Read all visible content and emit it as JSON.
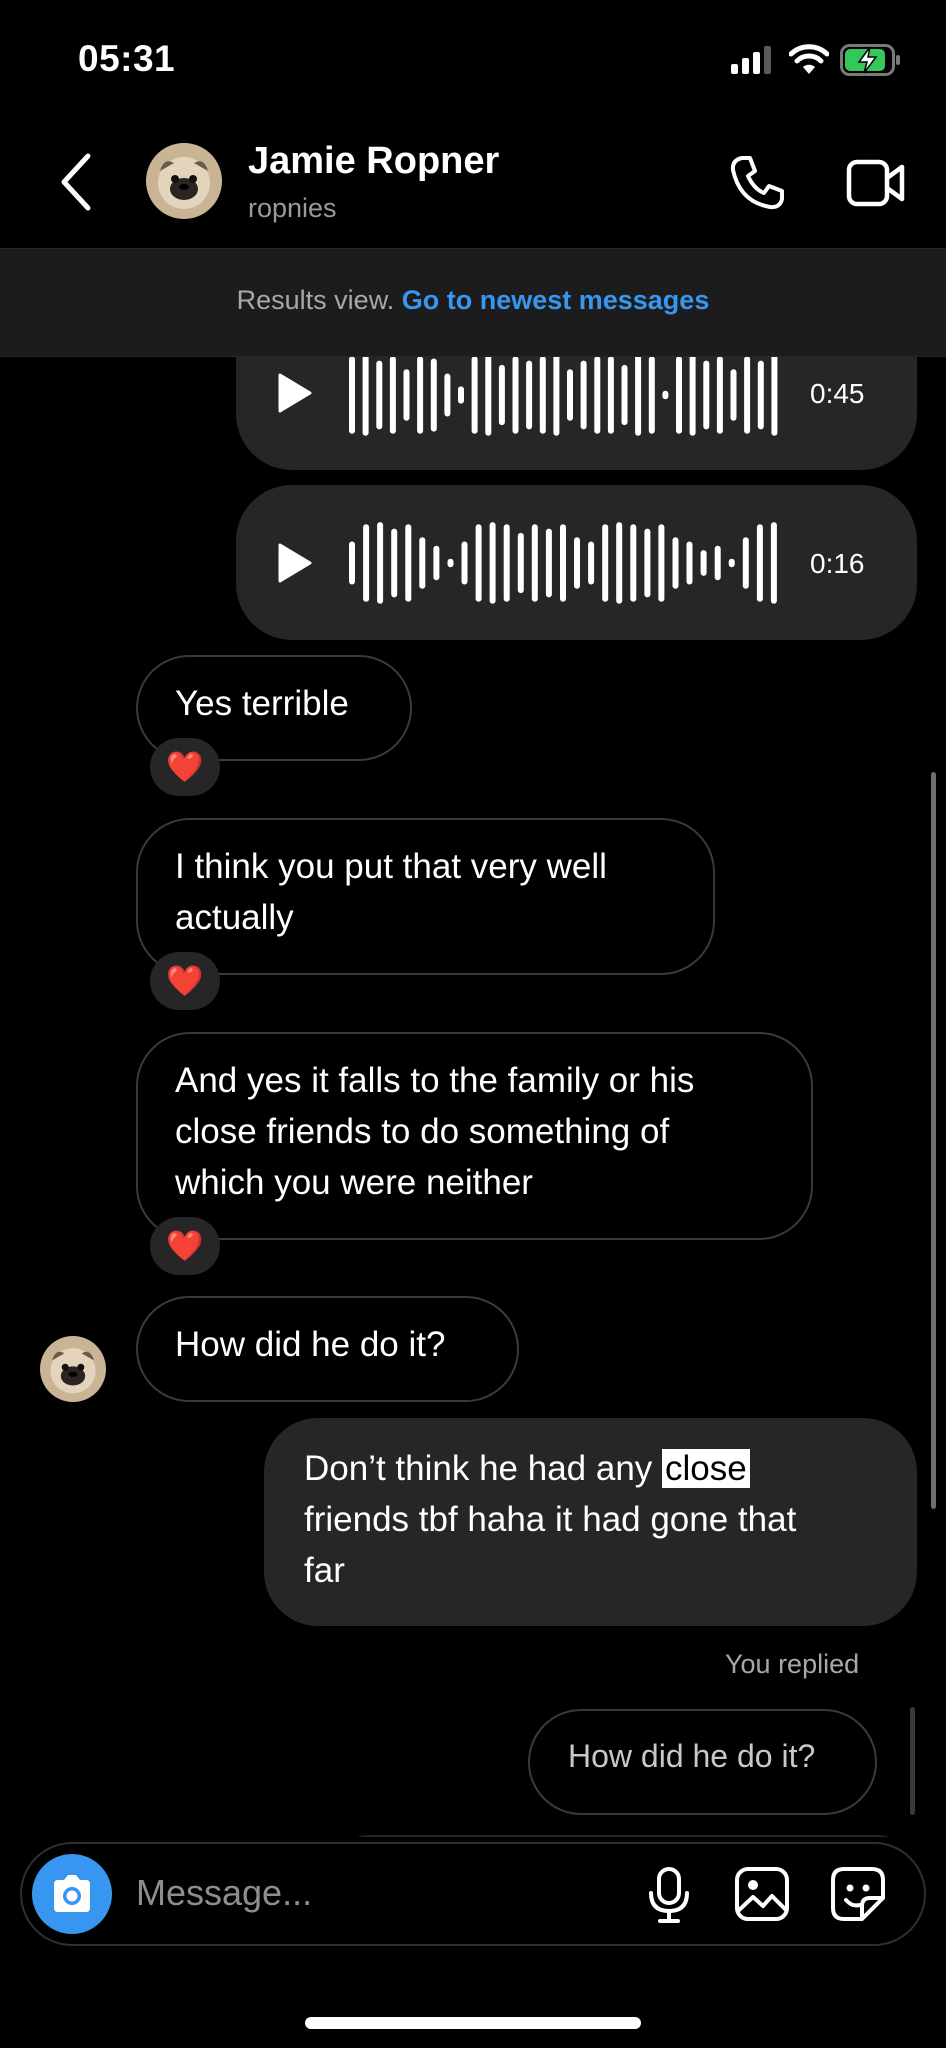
{
  "status": {
    "time": "05:31"
  },
  "header": {
    "name": "Jamie Ropner",
    "username": "ropnies"
  },
  "banner": {
    "prefix": "Results view.",
    "link": "Go to newest messages"
  },
  "messages": {
    "voice1_duration": "0:45",
    "voice2_duration": "0:16",
    "msg1": "Yes terrible",
    "msg2_line1": "I think you put that very well",
    "msg2_line2": "actually",
    "msg3_line1": "And yes it falls to the family or his",
    "msg3_line2": "close friends to do something of",
    "msg3_line3": "which you were neither",
    "msg4": "How did he do it?",
    "out1_before": "Don’t think he had any",
    "out1_highlight": "close",
    "out1_line2": "friends tbf haha it had gone that",
    "out1_line3": "far",
    "you_replied": "You replied",
    "reply_quote": "How did he do it?",
    "reaction": "❤️"
  },
  "composer": {
    "placeholder": "Message..."
  },
  "colors": {
    "accent": "#3797f0",
    "bubble_out": "#262626",
    "background": "#000000"
  },
  "icons": [
    "back-chevron-icon",
    "phone-icon",
    "video-camera-icon",
    "play-icon",
    "camera-icon",
    "microphone-icon",
    "gallery-icon",
    "sticker-icon",
    "signal-icon",
    "wifi-icon",
    "battery-charging-icon"
  ]
}
